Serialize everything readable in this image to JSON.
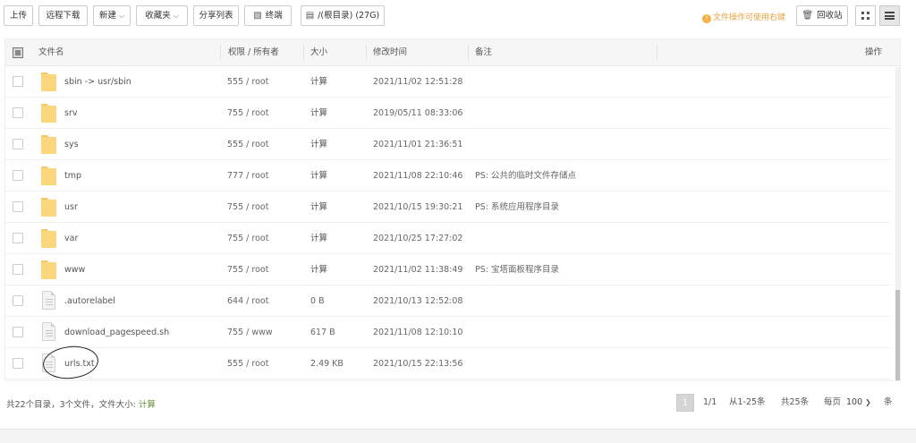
{
  "toolbar": {
    "upload": "上传",
    "remote_download": "远程下载",
    "new": "新建",
    "favorites": "收藏夹",
    "share_list": "分享列表",
    "terminal": "终端",
    "path": "/(根目录) (27G)",
    "tip": "文件操作可使用右键",
    "recycle_bin": "回收站"
  },
  "table": {
    "headers": {
      "name": "文件名",
      "perm_owner": "权限 / 所有者",
      "size": "大小",
      "mtime": "修改时间",
      "remark": "备注",
      "action": "操作"
    },
    "rows": [
      {
        "name": "sbin -> usr/sbin",
        "type": "folder",
        "perm": "555 / root",
        "size": "计算",
        "mtime": "2021/11/02 12:51:28",
        "remark": ""
      },
      {
        "name": "srv",
        "type": "folder",
        "perm": "755 / root",
        "size": "计算",
        "mtime": "2019/05/11 08:33:06",
        "remark": ""
      },
      {
        "name": "sys",
        "type": "folder",
        "perm": "555 / root",
        "size": "计算",
        "mtime": "2021/11/01 21:36:51",
        "remark": ""
      },
      {
        "name": "tmp",
        "type": "folder",
        "perm": "777 / root",
        "size": "计算",
        "mtime": "2021/11/08 22:10:46",
        "remark": "PS: 公共的临时文件存储点"
      },
      {
        "name": "usr",
        "type": "folder",
        "perm": "755 / root",
        "size": "计算",
        "mtime": "2021/10/15 19:30:21",
        "remark": "PS: 系统应用程序目录"
      },
      {
        "name": "var",
        "type": "folder",
        "perm": "755 / root",
        "size": "计算",
        "mtime": "2021/10/25 17:27:02",
        "remark": ""
      },
      {
        "name": "www",
        "type": "folder",
        "perm": "755 / root",
        "size": "计算",
        "mtime": "2021/11/02 11:38:49",
        "remark": "PS: 宝塔面板程序目录"
      },
      {
        "name": ".autorelabel",
        "type": "file",
        "perm": "644 / root",
        "size": "0 B",
        "mtime": "2021/10/13 12:52:08",
        "remark": ""
      },
      {
        "name": "download_pagespeed.sh",
        "type": "file",
        "perm": "755 / www",
        "size": "617 B",
        "mtime": "2021/11/08 12:10:10",
        "remark": ""
      },
      {
        "name": "urls.txt",
        "type": "file",
        "perm": "555 / root",
        "size": "2.49 KB",
        "mtime": "2021/10/15 22:13:56",
        "remark": ""
      }
    ]
  },
  "footer": {
    "summary": "共22个目录，3个文件，文件大小: ",
    "summary_calc": "计算",
    "current_page": "1",
    "page_count": "1/1",
    "range": "从1-25条",
    "total": "共25条",
    "per_page_label": "每页",
    "per_page_value": "100",
    "per_page_unit": "条"
  },
  "colors": {
    "accent_tip": "#e8a33d",
    "calc_link": "#6a8f3a",
    "folder": "#fad67d"
  }
}
